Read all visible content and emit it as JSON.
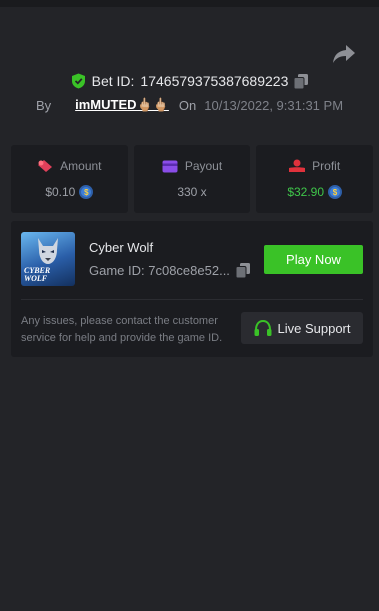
{
  "bet": {
    "label": "Bet ID:",
    "id": "1746579375387689223"
  },
  "meta": {
    "by_label": "By",
    "username": "imMUTED🖕🏼🖕🏼",
    "on_label": "On",
    "date": "10/13/2022, 9:31:31 PM"
  },
  "stats": {
    "amount": {
      "label": "Amount",
      "value": "$0.10"
    },
    "payout": {
      "label": "Payout",
      "value": "330 x"
    },
    "profit": {
      "label": "Profit",
      "value": "$32.90"
    }
  },
  "game": {
    "thumbnail_text": "CYBER WOLF",
    "name": "Cyber Wolf",
    "id_text": "Game ID: 7c08ce8e52..."
  },
  "actions": {
    "play_label": "Play Now",
    "support_label": "Live Support"
  },
  "support_note": "Any issues, please contact the customer service for help and provide the game ID.",
  "colors": {
    "background": "#232428",
    "card": "#1b1c20",
    "accent_green": "#3ac227",
    "profit_green": "#3fc64a",
    "amount_icon": "#e0405a",
    "payout_icon": "#8a4de8",
    "profit_icon": "#e0323c"
  },
  "icons": [
    "share-icon",
    "shield-check-icon",
    "copy-icon",
    "amount-icon",
    "payout-icon",
    "profit-icon",
    "coin-icon",
    "headset-icon"
  ]
}
